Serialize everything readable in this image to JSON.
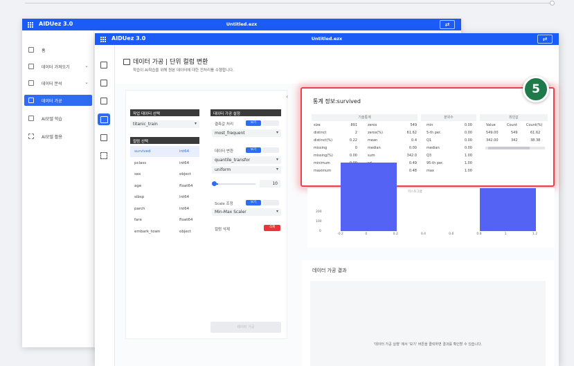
{
  "app_name": "AIDUez 3.0",
  "file_name": "Untitled.ezx",
  "sidebar": {
    "items": [
      {
        "label": "홈",
        "icon": "home-icon"
      },
      {
        "label": "데이터 가져오기",
        "icon": "import-icon",
        "chevron": "⌄"
      },
      {
        "label": "데이터 분석",
        "icon": "analysis-icon",
        "chevron": "⌄"
      },
      {
        "label": "데이터 가공",
        "icon": "process-icon",
        "active": true
      },
      {
        "label": "AI모델 학습",
        "icon": "train-icon"
      },
      {
        "label": "AI모델 활용",
        "icon": "deploy-icon"
      }
    ]
  },
  "page": {
    "title": "데이터 가공 | 단위 컬럼 변환",
    "subtitle": "학습이 AI학습을 위해 원본 데이터에 대한 전처리를 수행합니다."
  },
  "left": {
    "dataset_section": "작업 데이터 선택",
    "dataset_value": "titanic_train",
    "column_section": "컬럼 선택",
    "columns": [
      {
        "name": "survived",
        "type": "int64"
      },
      {
        "name": "pclass",
        "type": "int64"
      },
      {
        "name": "sex",
        "type": "object"
      },
      {
        "name": "age",
        "type": "float64"
      },
      {
        "name": "sibsp",
        "type": "int64"
      },
      {
        "name": "parch",
        "type": "int64"
      },
      {
        "name": "fare",
        "type": "float64"
      },
      {
        "name": "embark_town",
        "type": "object"
      }
    ],
    "process_section": "데이터 가공 설정",
    "missing_label": "결측값 처리",
    "missing_value": "most_frequent",
    "transform_label": "데이터 변환",
    "transform_value": "quantile_transfor",
    "transform_dist": "uniform",
    "slider_value": "10",
    "scale_label": "Scale 조정",
    "scale_value": "Min-Max Scaler",
    "delete_label": "컬럼 삭제",
    "view_label": "보기",
    "delete_button": "삭제",
    "exec_button": "데이터 가공"
  },
  "stats": {
    "title": "통계 정보:survived",
    "group1_title": "기술통계",
    "group1": [
      [
        "size",
        "891",
        "zeros",
        "549"
      ],
      [
        "distinct",
        "2",
        "zeros(%)",
        "61.62"
      ],
      [
        "distinct(%)",
        "0.22",
        "mean",
        "0.4"
      ],
      [
        "missing",
        "0",
        "median",
        "0.00"
      ],
      [
        "missing(%)",
        "0.00",
        "sum",
        "342.0"
      ],
      [
        "minimum",
        "0.00",
        "sd",
        "0.49"
      ],
      [
        "maximum",
        "1.00",
        "skewness",
        "0.48"
      ]
    ],
    "group2_title": "분위수",
    "group2": [
      [
        "min",
        "0.00"
      ],
      [
        "5-th per.",
        "0.00"
      ],
      [
        "Q1",
        "0.00"
      ],
      [
        "median",
        "0.00"
      ],
      [
        "Q3",
        "1.00"
      ],
      [
        "95-th per.",
        "1.00"
      ],
      [
        "max",
        "1.00"
      ]
    ],
    "group3_title": "최빈값",
    "group3_headers": [
      "Value",
      "Count",
      "Count(%)"
    ],
    "group3": [
      [
        "549.00",
        "549",
        "61.62"
      ],
      [
        "342.00",
        "342",
        "38.38"
      ]
    ]
  },
  "badge": "5",
  "histogram": {
    "label": "히스토그램",
    "y_ticks": [
      "200",
      "100",
      "0"
    ],
    "x_ticks": [
      "-0.2",
      "0",
      "0.2",
      "0.4",
      "0.6",
      "0.8",
      "1",
      "1.2"
    ]
  },
  "chart_data": {
    "type": "bar",
    "categories": [
      "0",
      "1"
    ],
    "values": [
      549,
      342
    ],
    "ylim": [
      0,
      300
    ],
    "xlim": [
      -0.3,
      1.25
    ]
  },
  "result": {
    "title": "데이터 가공 결과",
    "message": "'데이터 가공 실행' 에서 '보기' 버튼을 클릭하면 결과를 확인할 수 있습니다."
  }
}
